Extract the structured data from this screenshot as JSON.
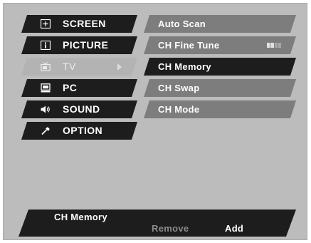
{
  "menu": {
    "items": [
      {
        "label": "SCREEN",
        "icon": "screen-icon"
      },
      {
        "label": "PICTURE",
        "icon": "picture-icon"
      },
      {
        "label": "TV",
        "icon": "tv-icon",
        "active": true
      },
      {
        "label": "PC",
        "icon": "pc-icon"
      },
      {
        "label": "SOUND",
        "icon": "sound-icon"
      },
      {
        "label": "OPTION",
        "icon": "option-icon"
      }
    ]
  },
  "submenu": {
    "items": [
      {
        "label": "Auto Scan"
      },
      {
        "label": "CH Fine Tune"
      },
      {
        "label": "CH Memory",
        "selected": true
      },
      {
        "label": "CH Swap"
      },
      {
        "label": "CH Mode"
      }
    ],
    "fine_tune_indicator": "level-bars-icon"
  },
  "footer": {
    "title": "CH Memory",
    "option_remove": "Remove",
    "option_add": "Add"
  },
  "colors": {
    "panel": "#bcbcbc",
    "item_dark": "#1d1d1d",
    "item_gray": "#7d7d7d",
    "active_item": "#b3b3b3",
    "disabled_text": "#8a8a8a"
  }
}
